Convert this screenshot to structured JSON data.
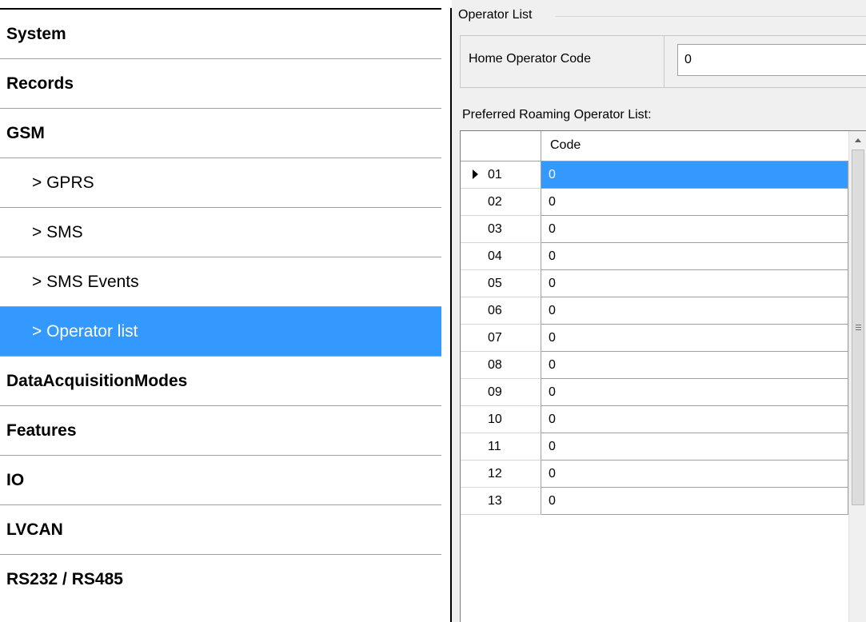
{
  "sidebar": {
    "items": [
      {
        "label": "System",
        "level": 0
      },
      {
        "label": "Records",
        "level": 0
      },
      {
        "label": "GSM",
        "level": 0
      },
      {
        "label": "> GPRS",
        "level": 1
      },
      {
        "label": "> SMS",
        "level": 1
      },
      {
        "label": "> SMS Events",
        "level": 1
      },
      {
        "label": "> Operator list",
        "level": 1,
        "selected": true
      },
      {
        "label": "DataAcquisitionModes",
        "level": 0
      },
      {
        "label": "Features",
        "level": 0
      },
      {
        "label": "IO",
        "level": 0
      },
      {
        "label": "LVCAN",
        "level": 0
      },
      {
        "label": "RS232 / RS485",
        "level": 0
      }
    ]
  },
  "panel": {
    "group_title": "Operator List",
    "home_operator": {
      "label": "Home Operator Code",
      "value": "0"
    },
    "roaming_label": "Preferred Roaming Operator List:",
    "grid": {
      "column_header": "Code",
      "rows": [
        {
          "num": "01",
          "code": "0",
          "selected": true
        },
        {
          "num": "02",
          "code": "0"
        },
        {
          "num": "03",
          "code": "0"
        },
        {
          "num": "04",
          "code": "0"
        },
        {
          "num": "05",
          "code": "0"
        },
        {
          "num": "06",
          "code": "0"
        },
        {
          "num": "07",
          "code": "0"
        },
        {
          "num": "08",
          "code": "0"
        },
        {
          "num": "09",
          "code": "0"
        },
        {
          "num": "10",
          "code": "0"
        },
        {
          "num": "11",
          "code": "0"
        },
        {
          "num": "12",
          "code": "0"
        },
        {
          "num": "13",
          "code": "0"
        }
      ]
    }
  },
  "colors": {
    "selection": "#3399ff",
    "panel_bg": "#f0f0f0"
  }
}
